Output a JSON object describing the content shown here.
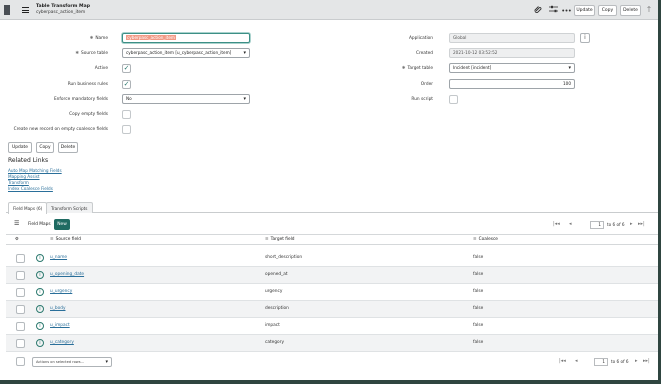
{
  "header": {
    "title": "Table Transform Map",
    "subtitle": "cyberpasc_action_item",
    "icons": [
      "paperclip-icon",
      "sliders-icon",
      "more-icon"
    ],
    "buttons": {
      "update": "Update",
      "copy": "Copy",
      "delete": "Delete"
    },
    "up_arrow": "↑"
  },
  "form": {
    "name_label": "Name",
    "name_value": "cyberpasc_action_item",
    "source_table_label": "Source table",
    "source_table_value": "cyberpasc_action_item [u_cyberpasc_action_item]",
    "active_label": "Active",
    "run_business_rules_label": "Run business rules",
    "enforce_mandatory_label": "Enforce mandatory fields",
    "enforce_mandatory_value": "No",
    "copy_empty_label": "Copy empty fields",
    "create_new_label": "Create new record on empty coalesce fields",
    "application_label": "Application",
    "application_value": "Global",
    "created_label": "Created",
    "created_value": "2021-10-12 03:52:52",
    "target_table_label": "Target table",
    "target_table_value": "Incident [incident]",
    "order_label": "Order",
    "order_value": "100",
    "run_script_label": "Run script",
    "check_mark": "✓",
    "caret": "▾",
    "info_glyph": "i"
  },
  "form_buttons": {
    "update": "Update",
    "copy": "Copy",
    "delete": "Delete"
  },
  "related_links": {
    "heading": "Related Links",
    "links": [
      "Auto Map Matching Fields",
      "Mapping Assist",
      "Transform",
      "Index Coalesce Fields"
    ]
  },
  "tabs": [
    "Field Maps (6)",
    "Transform Scripts"
  ],
  "list": {
    "label": "Field Maps",
    "new_label": "New",
    "page_value": "1",
    "page_text": "to 6 of 6",
    "columns": [
      "Source field",
      "Target field",
      "Coalesce"
    ],
    "rows": [
      {
        "source": "u_name",
        "target": "short_description",
        "coalesce": "false"
      },
      {
        "source": "u_opening_date",
        "target": "opened_at",
        "coalesce": "false"
      },
      {
        "source": "u_urgency",
        "target": "urgency",
        "coalesce": "false"
      },
      {
        "source": "u_body",
        "target": "description",
        "coalesce": "false"
      },
      {
        "source": "u_impact",
        "target": "impact",
        "coalesce": "false"
      },
      {
        "source": "u_category",
        "target": "category",
        "coalesce": "false"
      }
    ],
    "footer_select": "Actions on selected rows...",
    "footer_page_text": "to 6 of 6"
  }
}
